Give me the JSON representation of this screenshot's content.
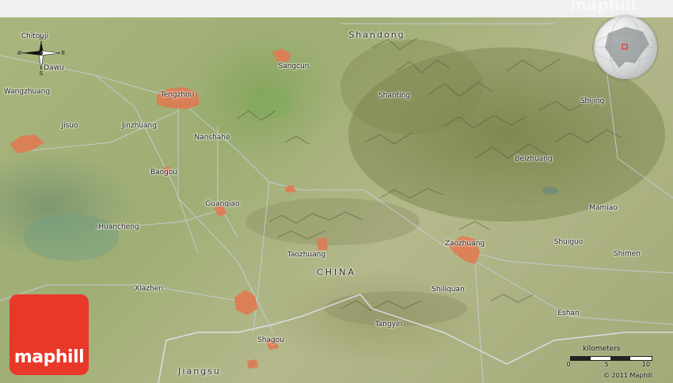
{
  "brand": {
    "logo_text": "maphill",
    "watermark": "maphill",
    "copyright": "© 2011 Maphill"
  },
  "compass": {
    "n": "N",
    "s": "S",
    "e": "E",
    "w": "W"
  },
  "scale": {
    "title": "kilometers",
    "ticks": [
      "0",
      "5",
      "10"
    ]
  },
  "labels": {
    "chitouji": "Chitouji",
    "dawu": "Dawu",
    "wangzhuang": "Wangzhuang",
    "jisuo": "Jisuo",
    "jinzhuang": "Jinzhuang",
    "tengzhou": "Tengzhou",
    "nanshahe": "Nanshahe",
    "baogou": "Baogou",
    "guanqiao": "Guanqiao",
    "huancheng": "Huancheng",
    "taozhuang": "Taozhuang",
    "xiazhen": "Xiazhen",
    "shagou": "Shagou",
    "jiangsu": "Jiangsu",
    "shandong": "Shandong",
    "sangcun": "Sangcun",
    "shanting": "Shanting",
    "shijing": "Shijing",
    "beizhuang": "Beizhuang",
    "mamiao": "Mamiao",
    "shuiguo": "Shuiguo",
    "shimen": "Shimen",
    "zaozhuang": "Zaozhuang",
    "china": "CHINA",
    "shiliquan": "Shiliquan",
    "tangyin": "Tangyin",
    "eshan": "Eshan"
  },
  "colors": {
    "urban": "#e07a52",
    "road": "#c7cfe0",
    "border": "#d9dfe8",
    "logo": "#e8382a"
  }
}
